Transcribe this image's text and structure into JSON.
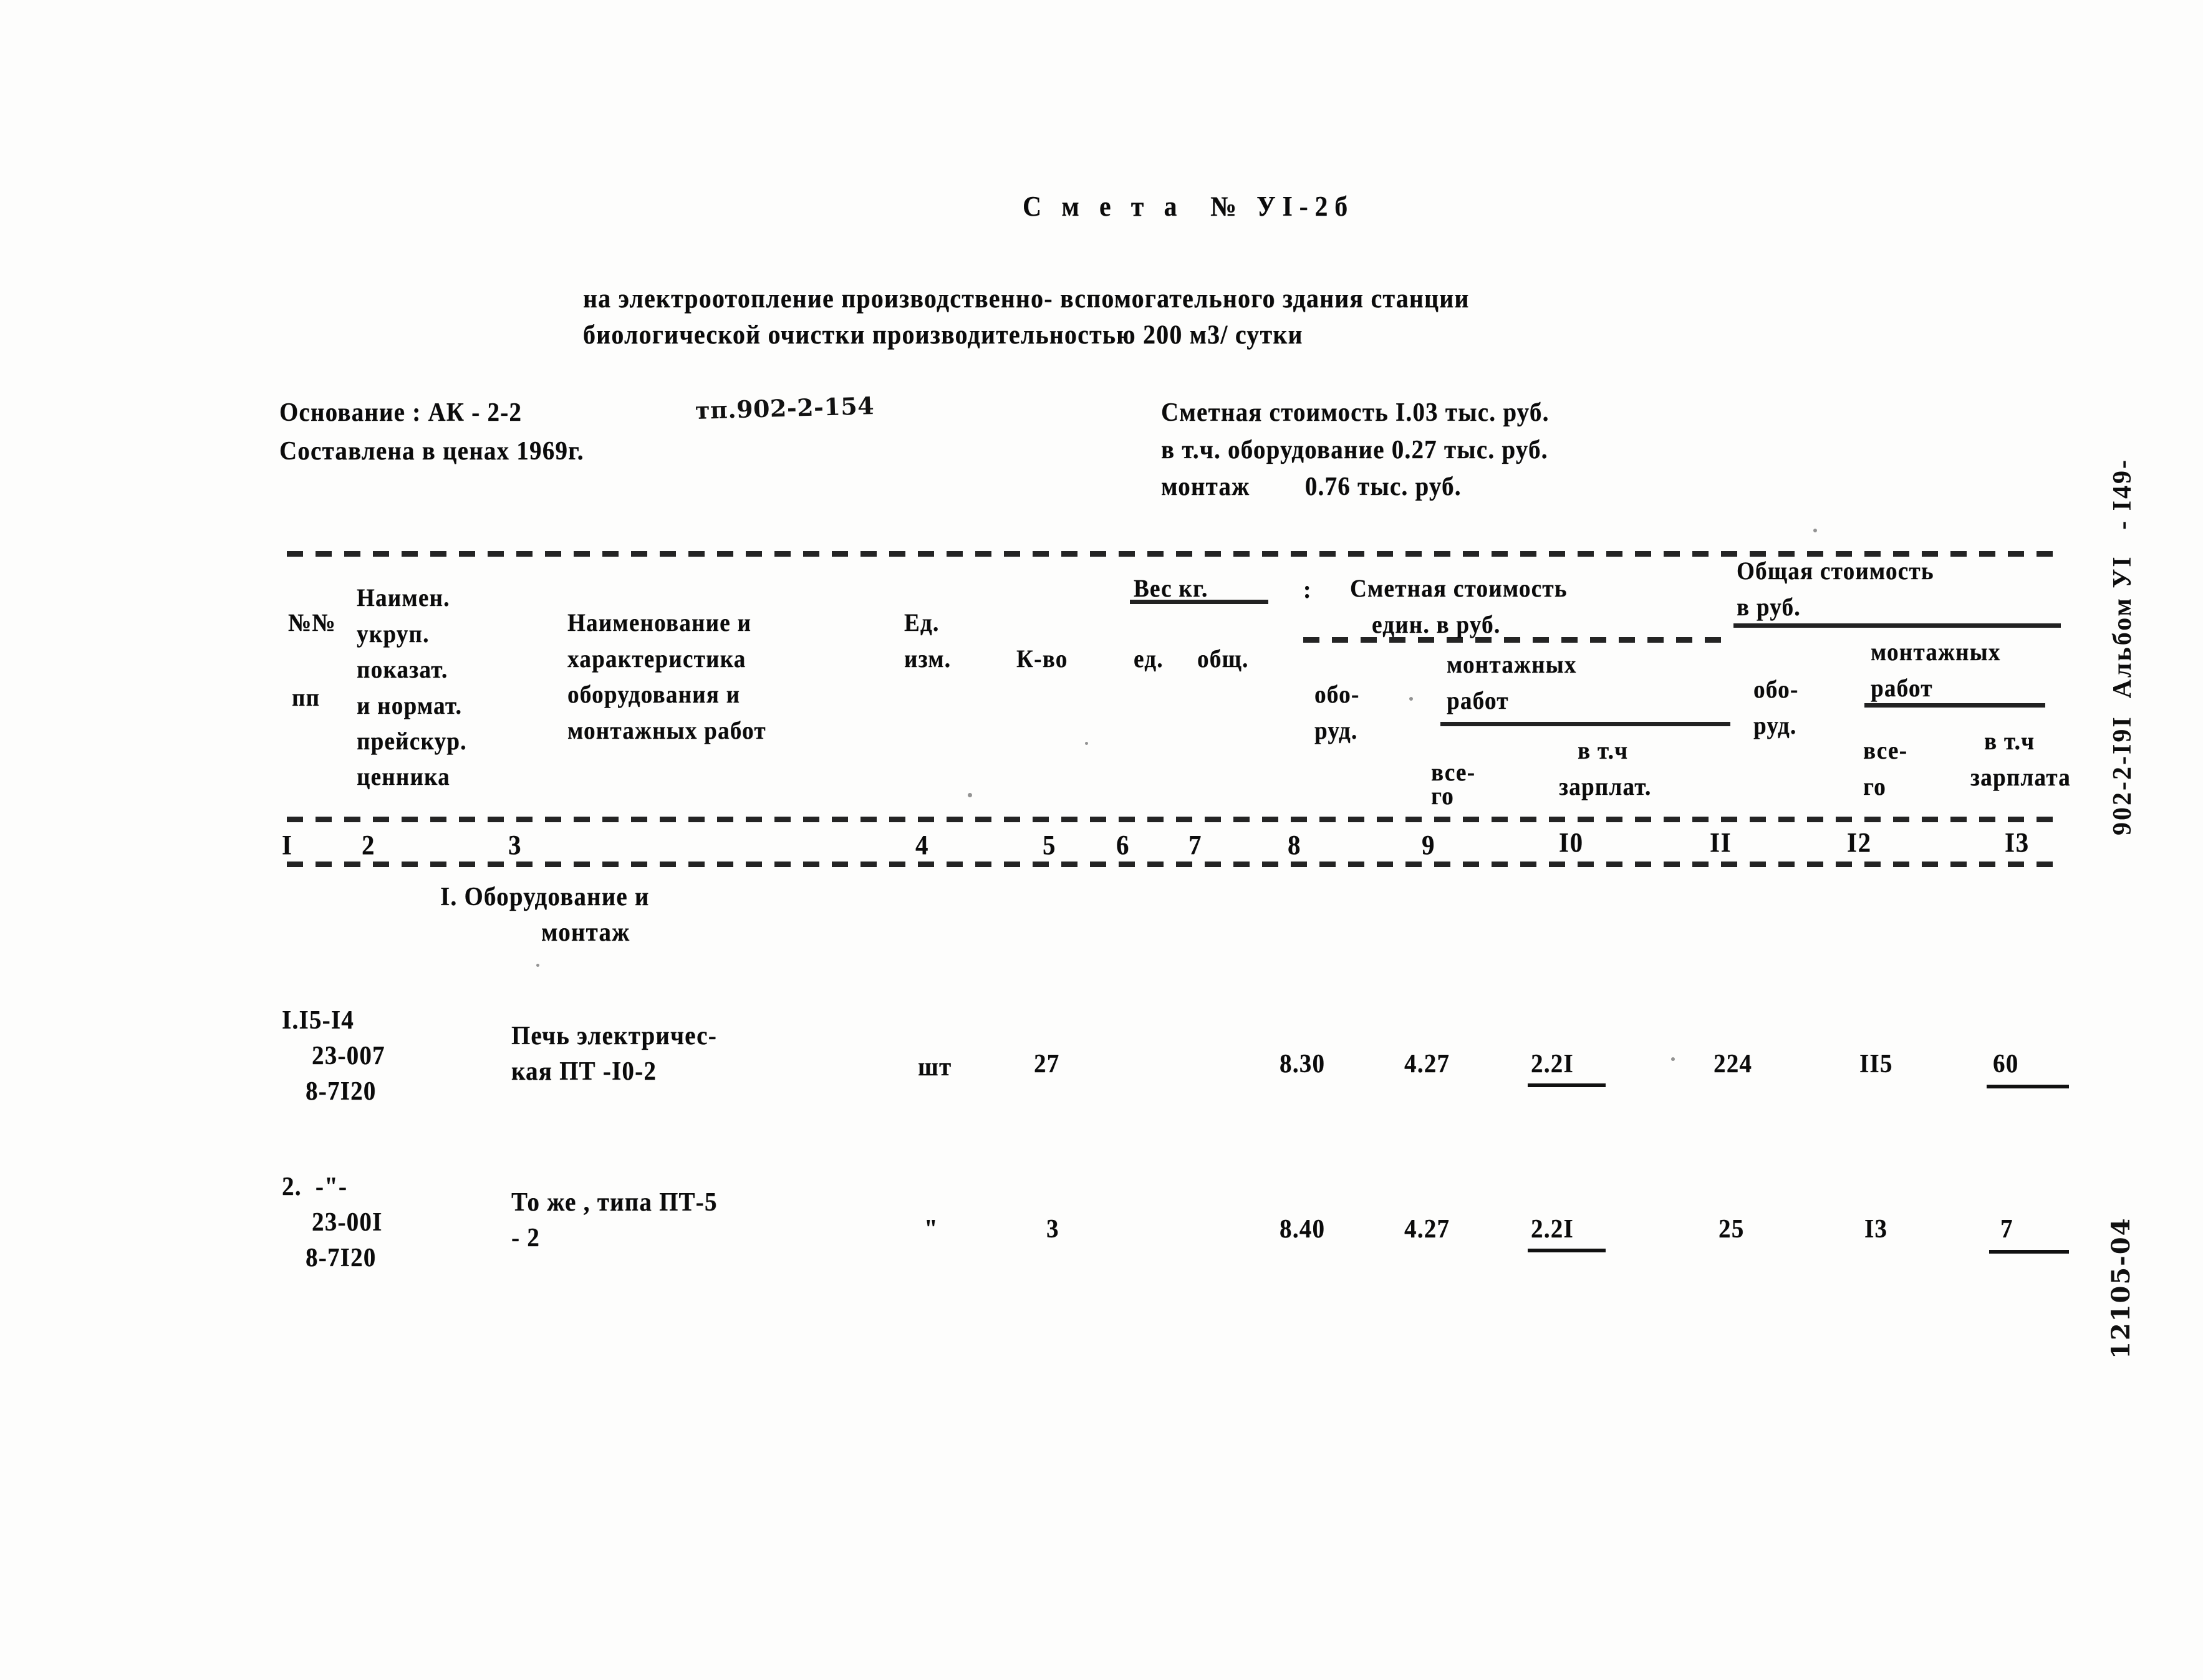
{
  "document": {
    "title": "С м е т а  № УI-2б",
    "subtitle_line1": "на электроотопление производственно- вспомогательного здания станции",
    "subtitle_line2": "биологической очистки производительностью 200 м3/ сутки",
    "basis_label": "Основание : АК - 2-2",
    "basis_handwritten": "тп.902-2-154",
    "prices_line": "Составлена в ценах 1969г.",
    "cost_total": "Сметная стоимость I.03 тыс. руб.",
    "cost_equipment": "в т.ч. оборудование 0.27 тыс. руб.",
    "cost_mounting": "монтаж        0.76 тыс. руб.",
    "margin_code": "902-2-I9I  Альбом УI   - I49-",
    "margin_handwritten": "12105-04"
  },
  "table": {
    "headers": {
      "col1_line1": "№№",
      "col1_line2": "пп",
      "col2_line1": "Наимен.",
      "col2_line2": "укруп.",
      "col2_line3": "показат.",
      "col2_line4": "и нормат.",
      "col2_line5": "прейскур.",
      "col2_line6": "ценника",
      "col3_line1": "Наименование и",
      "col3_line2": "характеристика",
      "col3_line3": "оборудования и",
      "col3_line4": "монтажных работ",
      "col4_line1": "Ед.",
      "col4_line2": "изм.",
      "col5": "К-во",
      "weight_group": "Вес кг.",
      "col6": "ед.",
      "col7": "общ.",
      "estimate_group_line1": "Сметная стоимость",
      "estimate_group_line2": "един. в руб.",
      "col8_line1": "обо-",
      "col8_line2": "руд.",
      "mount_group_line1": "монтажных",
      "mount_group_line2": "работ",
      "col9_line1": "все-",
      "col9_line2": "го",
      "col10_line1": "в т.ч",
      "col10_line2": "зарплат.",
      "total_group_line1": "Общая стоимость",
      "total_group_line2": "в руб.",
      "col11_line1": "обо-",
      "col11_line2": "руд.",
      "total_mount_line1": "монтажных",
      "total_mount_line2": "работ",
      "col12_line1": "все-",
      "col12_line2": "го",
      "col13_line1": "в т.ч",
      "col13_line2": "зарплата"
    },
    "column_numbers": [
      "I",
      "2",
      "3",
      "4",
      "5",
      "6",
      "7",
      "8",
      "9",
      "I0",
      "II",
      "I2",
      "I3"
    ],
    "section_title_line1": "I. Оборудование и",
    "section_title_line2": "монтаж",
    "rows": [
      {
        "code_line1": "I.I5-I4",
        "code_line2": "23-007",
        "code_line3": "8-7I20",
        "name_line1": "Печь электричес-",
        "name_line2": "кая ПТ -I0-2",
        "unit": "шт",
        "qty": "27",
        "weight_unit": "",
        "weight_total": "",
        "cost_equip": "8.30",
        "cost_mount_all": "4.27",
        "cost_mount_salary": "2.2I",
        "total_equip": "224",
        "total_mount_all": "II5",
        "total_mount_salary": "60"
      },
      {
        "code_line1": "2.  -\"-",
        "code_line2": "23-00I",
        "code_line3": "8-7I20",
        "name_line1": "То же , типа ПТ-5",
        "name_line2": "- 2",
        "unit": "\"",
        "qty": "3",
        "weight_unit": "",
        "weight_total": "",
        "cost_equip": "8.40",
        "cost_mount_all": "4.27",
        "cost_mount_salary": "2.2I",
        "total_equip": "25",
        "total_mount_all": "I3",
        "total_mount_salary": "7"
      }
    ]
  }
}
